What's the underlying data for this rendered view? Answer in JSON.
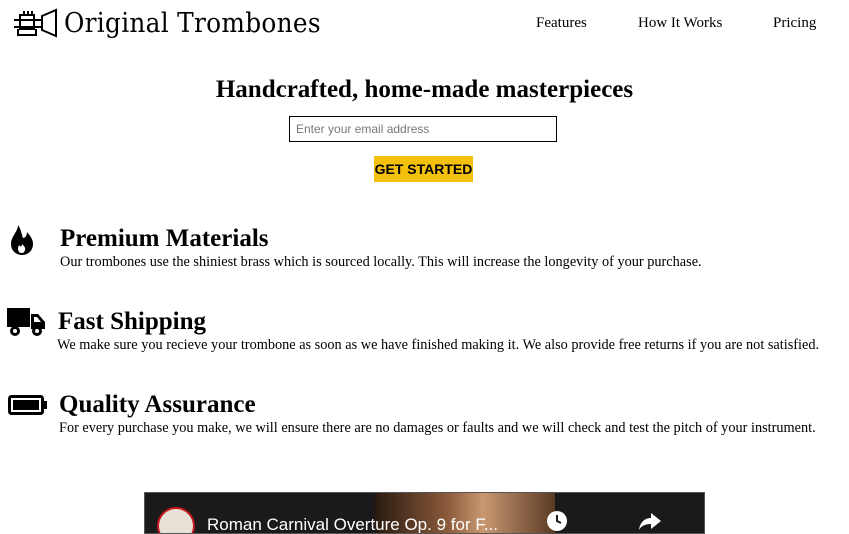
{
  "brand": {
    "name": "Original Trombones",
    "logo_icon": "trombone-icon"
  },
  "nav": {
    "items": [
      "Features",
      "How It Works",
      "Pricing"
    ]
  },
  "hero": {
    "title": "Handcrafted, home-made masterpieces",
    "email_placeholder": "Enter your email address",
    "cta_label": "GET STARTED",
    "cta_color": "#f3c10d"
  },
  "features": [
    {
      "icon": "flame-icon",
      "title": "Premium Materials",
      "description": "Our trombones use the shiniest brass which is sourced locally. This will increase the longevity of your purchase."
    },
    {
      "icon": "truck-icon",
      "title": "Fast Shipping",
      "description": "We make sure you recieve your trombone as soon as we have finished making it. We also provide free returns if you are not satisfied."
    },
    {
      "icon": "battery-icon",
      "title": "Quality Assurance",
      "description": "For every purchase you make, we will ensure there are no damages or faults and we will check and test the pitch of your instrument."
    }
  ],
  "video": {
    "title": "Roman Carnival Overture Op. 9 for F..."
  }
}
